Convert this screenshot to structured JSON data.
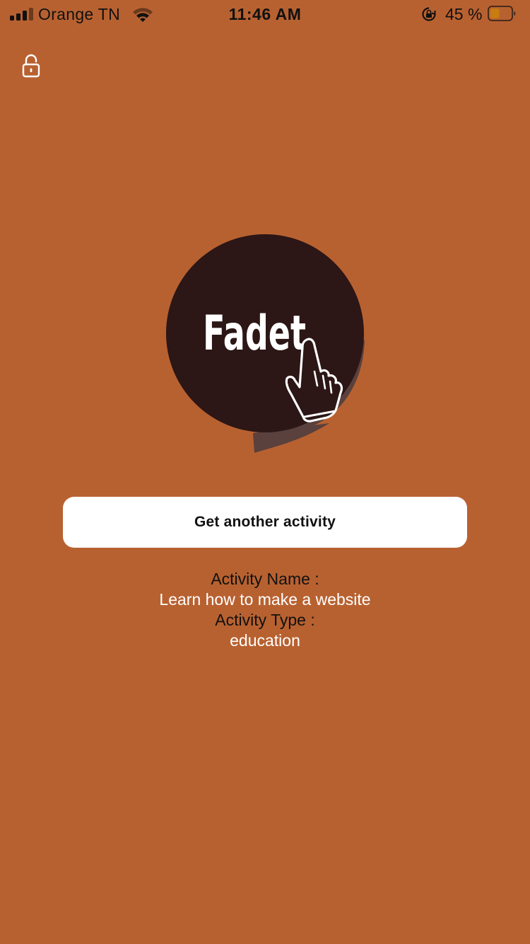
{
  "status_bar": {
    "carrier": "Orange TN",
    "time": "11:46 AM",
    "battery_percent": "45 %",
    "battery_level": 0.45,
    "signal_bars_active": 3,
    "signal_bars_total": 4
  },
  "header": {
    "lock_icon": "unlocked-padlock-icon"
  },
  "logo": {
    "text": "Fadet",
    "icon": "pointing-hand-icon"
  },
  "main": {
    "button_label": "Get another activity",
    "activity_name_label": "Activity Name :",
    "activity_name": "Learn how to make a website",
    "activity_type_label": "Activity Type :",
    "activity_type": "education"
  },
  "colors": {
    "background": "#b86130",
    "logo_circle": "#2c1616",
    "logo_shadow": "#5a413d",
    "button_bg": "#ffffff",
    "value_text": "#ffffff",
    "label_text": "#111111",
    "battery_fill": "#c97c10"
  }
}
